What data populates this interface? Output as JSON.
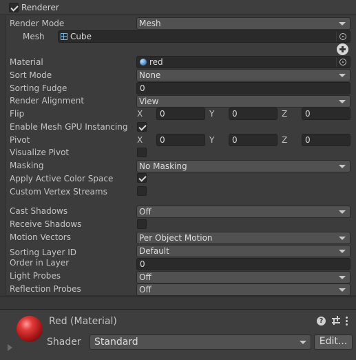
{
  "header": {
    "title": "Renderer",
    "enabled": true
  },
  "rows": {
    "render_mode": {
      "label": "Render Mode",
      "value": "Mesh"
    },
    "mesh": {
      "label": "Mesh",
      "value": "Cube"
    },
    "material": {
      "label": "Material",
      "value": "red"
    },
    "sort_mode": {
      "label": "Sort Mode",
      "value": "None"
    },
    "sorting_fudge": {
      "label": "Sorting Fudge",
      "value": "0"
    },
    "render_alignment": {
      "label": "Render Alignment",
      "value": "View"
    },
    "flip": {
      "label": "Flip",
      "x_label": "X",
      "x": "0",
      "y_label": "Y",
      "y": "0",
      "z_label": "Z",
      "z": "0"
    },
    "gpu_instancing": {
      "label": "Enable Mesh GPU Instancing",
      "checked": true
    },
    "pivot": {
      "label": "Pivot",
      "x_label": "X",
      "x": "0",
      "y_label": "Y",
      "y": "0",
      "z_label": "Z",
      "z": "0"
    },
    "visualize_pivot": {
      "label": "Visualize Pivot",
      "checked": false
    },
    "masking": {
      "label": "Masking",
      "value": "No Masking"
    },
    "apply_active_color_space": {
      "label": "Apply Active Color Space",
      "checked": true
    },
    "custom_vertex_streams": {
      "label": "Custom Vertex Streams",
      "checked": false
    },
    "cast_shadows": {
      "label": "Cast Shadows",
      "value": "Off"
    },
    "receive_shadows": {
      "label": "Receive Shadows",
      "checked": false
    },
    "motion_vectors": {
      "label": "Motion Vectors",
      "value": "Per Object Motion"
    },
    "sorting_layer_id": {
      "label": "Sorting Layer ID",
      "value": "Default"
    },
    "order_in_layer": {
      "label": "Order in Layer",
      "value": "0"
    },
    "light_probes": {
      "label": "Light Probes",
      "value": "Off"
    },
    "reflection_probes": {
      "label": "Reflection Probes",
      "value": "Off"
    }
  },
  "material_section": {
    "title": "Red (Material)",
    "shader_label": "Shader",
    "shader_value": "Standard",
    "edit_label": "Edit...",
    "help_glyph": "?"
  },
  "icons": {
    "mesh": "mesh-filter-icon",
    "material": "material-icon",
    "picker": "object-picker-icon",
    "add": "add-icon",
    "help": "help-icon",
    "presets": "presets-icon",
    "menu": "context-menu-icon"
  },
  "colors": {
    "background": "#383838",
    "panel": "#3c3c3c",
    "dropdown": "#515151",
    "field": "#2a2a2a",
    "text": "#c4c4c4",
    "sphere": "#d22a2a"
  }
}
